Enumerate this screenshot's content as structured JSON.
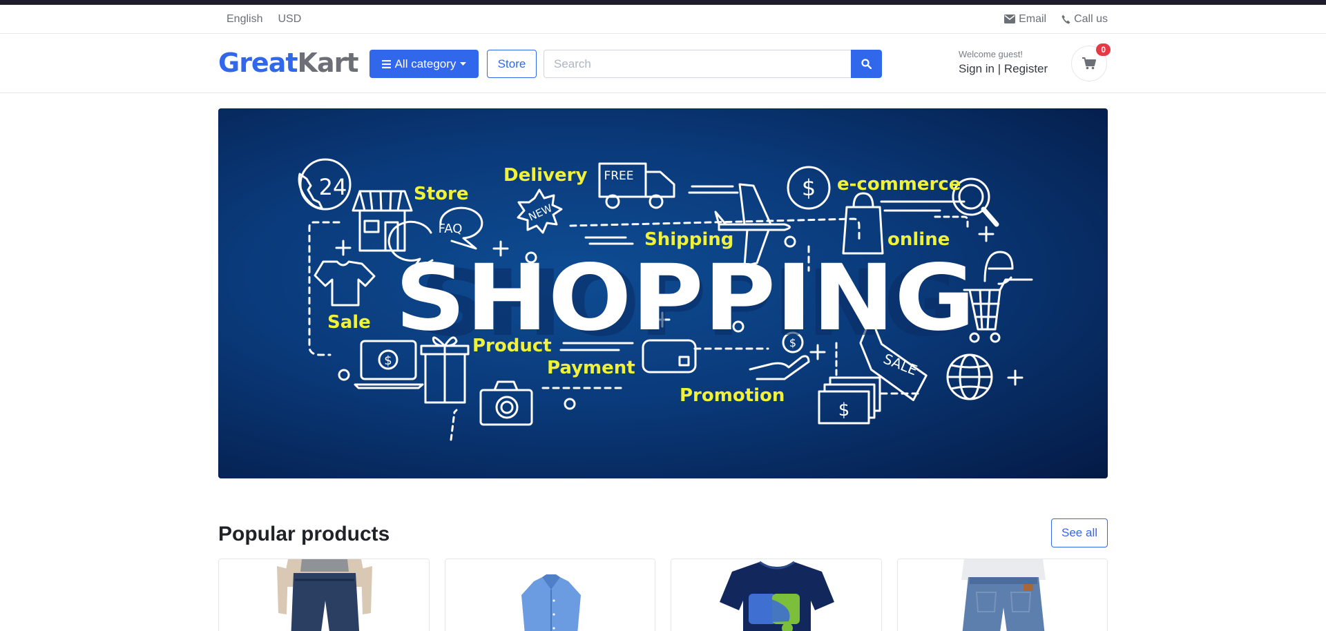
{
  "topbar": {
    "language": "English",
    "currency": "USD",
    "email_label": "Email",
    "call_label": "Call us"
  },
  "header": {
    "logo_part1": "Great",
    "logo_part2": "Kart",
    "category_button": "All category",
    "store_button": "Store",
    "search_placeholder": "Search",
    "welcome": "Welcome guest!",
    "sign_in": "Sign in",
    "separator": "|",
    "register": "Register",
    "cart_count": "0"
  },
  "banner": {
    "headline": "SHOPPING",
    "words": {
      "store": "Store",
      "delivery": "Delivery",
      "free": "FREE",
      "ecommerce": "e-commerce",
      "faq": "FAQ",
      "new": "NEW",
      "shipping": "Shipping",
      "online": "online",
      "sale": "Sale",
      "product": "Product",
      "payment": "Payment",
      "promotion": "Promotion",
      "sale_tag": "SALE",
      "hours": "24",
      "dollar": "$",
      "e": "e"
    }
  },
  "popular": {
    "title": "Popular products",
    "see_all": "See all"
  },
  "colors": {
    "brand": "#3167eb",
    "banner_yellow": "#f0f23a",
    "badge": "#e63946"
  }
}
